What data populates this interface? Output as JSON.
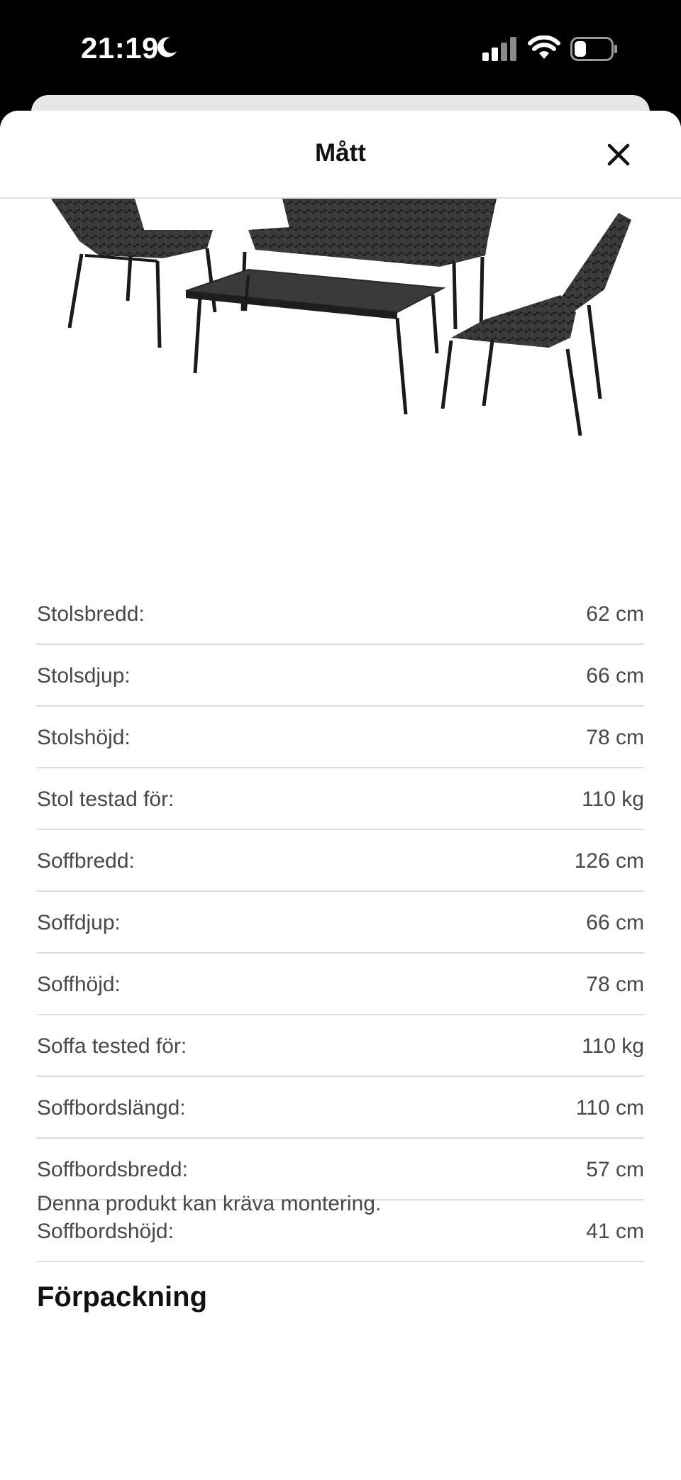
{
  "status_bar": {
    "time": "21:19",
    "icons": [
      "moon-icon",
      "cellular-signal-icon",
      "wifi-icon",
      "battery-icon"
    ]
  },
  "sheet": {
    "title": "Mått",
    "close_icon": "close-icon"
  },
  "product_image": {
    "icon": "outdoor-furniture-set-image"
  },
  "dimensions": [
    {
      "label": "Stolsbredd:",
      "value": "62 cm"
    },
    {
      "label": "Stolsdjup:",
      "value": "66 cm"
    },
    {
      "label": "Stolshöjd:",
      "value": "78 cm"
    },
    {
      "label": "Stol testad för:",
      "value": "110 kg"
    },
    {
      "label": "Soffbredd:",
      "value": "126 cm"
    },
    {
      "label": "Soffdjup:",
      "value": "66 cm"
    },
    {
      "label": "Soffhöjd:",
      "value": "78 cm"
    },
    {
      "label": "Soffa tested för:",
      "value": "110 kg"
    },
    {
      "label": "Soffbordslängd:",
      "value": "110 cm"
    },
    {
      "label": "Soffbordsbredd:",
      "value": "57 cm"
    },
    {
      "label": "Soffbordshöjd:",
      "value": "41 cm"
    }
  ],
  "assembly_note": "Denna produkt kan kräva montering.",
  "packaging_heading": "Förpackning",
  "colors": {
    "text_primary": "#111111",
    "text_secondary": "#484848",
    "divider": "#dcdcdc",
    "furniture": "#2e2e2e"
  }
}
